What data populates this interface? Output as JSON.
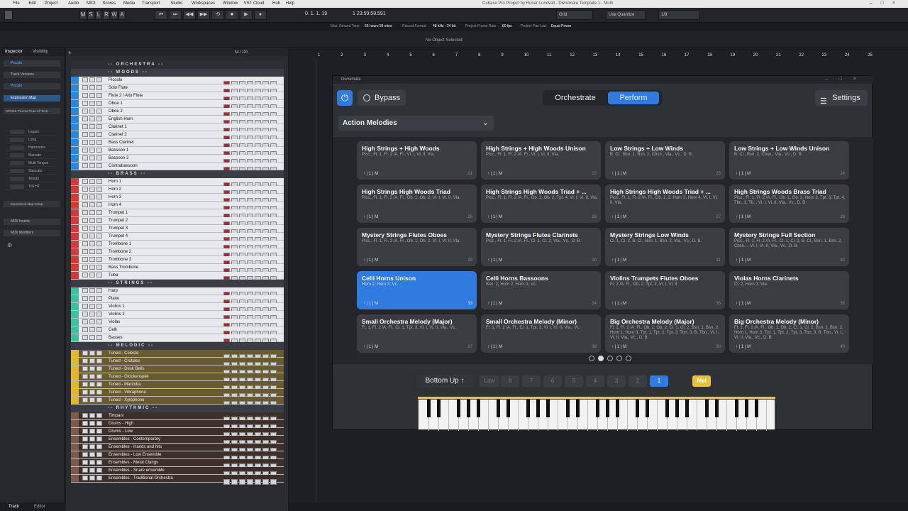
{
  "menu": [
    "File",
    "Edit",
    "Project",
    "Audio",
    "MIDI",
    "Scores",
    "Media",
    "Transport",
    "Studio",
    "Workspaces",
    "Window",
    "VST Cloud",
    "Hub",
    "Help"
  ],
  "window_title": "Cubase Pro Project by Runar Lundvall - Divisimate Template 1 - Multi",
  "toolbar": {
    "modes": [
      "M",
      "S",
      "L",
      "R",
      "W",
      "A"
    ],
    "position": "0. 1. 1. 19",
    "time": "1 23:59:58.591",
    "grid": "Grid",
    "quantize": "Use Quantize",
    "quant_value": "1/8"
  },
  "status": {
    "max_record_label": "Max. Record Time",
    "max_record": "56 hours 59 mins",
    "format_label": "Record Format",
    "format": "48 kHz - 24 bit",
    "frame_label": "Project Frame Rate",
    "frame": "60 fps",
    "pan_label": "Project Pan Law",
    "pan": "Equal Power"
  },
  "no_object": "No Object Selected",
  "inspector": {
    "tab1": "Inspector",
    "tab2": "Visibility",
    "track": "Piccolo",
    "versions": "Track Versions",
    "track2": "Piccolo",
    "expr_map": "Expression Map",
    "expr_value": "SPSOK Piccolo Flute All Tech.",
    "articulations": [
      "Legato",
      "Long",
      "Harmonics",
      "Marcato",
      "Multi Tongue",
      "Staccato",
      "Tenuto",
      "Trill HT"
    ],
    "expr_setup": "Expression Map Setup",
    "midi_inserts": "MIDI Inserts",
    "midi_modifiers": "MIDI Modifiers",
    "bottom_tabs": [
      "Track",
      "Editor"
    ]
  },
  "tracklist": {
    "counter": "54 / 120",
    "folders": [
      "ORCHESTRA",
      "WOODS",
      "BRASS",
      "STRINGS",
      "MELODIC",
      "RHYTHMIC"
    ],
    "woods": [
      "Piccolo",
      "Solo Flute",
      "Flute 2 / Alto Flute",
      "Oboe 1",
      "Oboe 2",
      "English Horn",
      "Clarinet 1",
      "Clarinet 2",
      "Bass Clarinet",
      "Bassoon 1",
      "Bassoon 2",
      "Contrabassoon"
    ],
    "brass": [
      "Horn 1",
      "Horn 2",
      "Horn 3",
      "Horn 4",
      "Trumpet 1",
      "Trumpet 2",
      "Trumpet 3",
      "Trumpet 4",
      "Trombone 1",
      "Trombone 2",
      "Trombone 3",
      "Bass Trombone",
      "Tuba"
    ],
    "strings": [
      "Harp",
      "Piano",
      "Violins 1",
      "Violins 2",
      "Violas",
      "Celli",
      "Basses"
    ],
    "melodic": [
      "Tuned - Celeste",
      "Tuned - Crotales",
      "Tuned - Desk Bells",
      "Tuned - Glockenspiel",
      "Tuned - Marimba",
      "Tuned - Vibraphone",
      "Tuned - Xylophone"
    ],
    "rhythmic": [
      "Timpani",
      "Drums - High",
      "Drums - Low",
      "Ensembles - Contemporary",
      "Ensembles - Hands and hits",
      "Ensembles - Low Ensemble",
      "Ensembles - Metal Clangs",
      "Ensembles - Snare ensemble",
      "Ensembles - Traditional Orchestra"
    ]
  },
  "ruler": [
    "1",
    "2",
    "3",
    "4",
    "5",
    "6",
    "7",
    "8",
    "9",
    "10",
    "11",
    "12",
    "13",
    "14",
    "15",
    "16",
    "17",
    "18",
    "19",
    "20",
    "21",
    "22",
    "23",
    "24",
    "25"
  ],
  "plugin": {
    "title": "Divisimate",
    "bypass": "Bypass",
    "tabs": [
      "Orchestrate",
      "Perform"
    ],
    "active_tab": "Perform",
    "settings": "Settings",
    "dropdown": "Action Melodies",
    "cards": [
      {
        "t": "High Strings + High Woods",
        "s": "Picc., Fl. 1, Fl. 2 /A. Fl., Vl. I, Vl. II, Vla.",
        "n": "21"
      },
      {
        "t": "High Strings + High Woods Unison",
        "s": "Picc., Fl. 1, Fl. 2 /A. Fl., Vl. I, Vl. II, Vla.",
        "n": "22"
      },
      {
        "t": "Low Strings + Low Winds",
        "s": "B. Cl., Bsn. 1, Bsn. 2, Cbsn., Vla., Vc., D. B.",
        "n": "23"
      },
      {
        "t": "Low Strings + Low Winds Unison",
        "s": "B. Cl., Bsn. 2, Cbsn., Vla., Vc., D. B.",
        "n": "24"
      },
      {
        "t": "High Strings High Woods Triad",
        "s": "Picc., Fl. 1, Fl. 2 /A. Fl., Ob. 1, Ob. 2, Vl. I, Vl. II, Vla.",
        "n": "25"
      },
      {
        "t": "High Strings High Woods Triad + ...",
        "s": "Picc., Fl. 1, Fl. 2 /A. Fl., Ob. 1, Ob. 2, Tpt. 4, Vl. I, Vl. II, Vla.",
        "n": "26"
      },
      {
        "t": "High Strings High Woods Triad + ...",
        "s": "Picc., Fl. 1, Fl. 2 /A. Fl., Ob. 1, 2. Horn 3, Horn 4, Vl. I, Vl. II, Vla.",
        "n": "27"
      },
      {
        "t": "High Strings Woods Brass Triad",
        "s": "Picc., Fl. 1, Fl. 2 /A. Fl., Ob. 1, Ob. 2, Horn 3, Tpt. 3, Tpt. 4, Tbn. 3, Tb. , Vl. I, Vl. II, Vla., Vc., D. B.",
        "n": "28"
      },
      {
        "t": "Mystery Strings Flutes Oboes",
        "s": "Picc., Fl. 1, Fl. 2 /A. Fl., Ob. 1, Ob. 2, Vl. I, Vl. II, Vla.",
        "n": "29"
      },
      {
        "t": "Mystery Strings Flutes Clarinets",
        "s": "Picc., Fl. 1, Fl. 2 /A. Fl., Cl. 1, Cl. 2, Vla., Vc., D. B.",
        "n": "30"
      },
      {
        "t": "Mystery Strings Low Winds",
        "s": "Cl. 1, Cl. 2, B. Cl., Bsn. 1, Bsn. 2, Vla., Vc., D. B.",
        "n": "31"
      },
      {
        "t": "Mystery Strings Full Section",
        "s": "Picc., Fl. 1, Fl. 2 /A. Fl., Cl. 1, Cl. 2, B. Cl., Bsn. 1, Bsn. 2, Cbsn., , Vl. I, Vl. II, Vla., Vc., D. B.",
        "n": "32"
      },
      {
        "t": "Celli Horns Unison",
        "s": "Horn 2, Horn 3, Vc.",
        "n": "33"
      },
      {
        "t": "Celli Horns Bassoons",
        "s": "Bsn. 2, Horn 2, Horn 3, Vc.",
        "n": "34"
      },
      {
        "t": "Violins Trumpets Flutes Oboes",
        "s": "Fl. 2 /A. Fl., Ob. 2, Tpt. 2, Vl. I, Vl. II",
        "n": "35"
      },
      {
        "t": "Violas Horns Clarinets",
        "s": "Cl. 2, Horn 3, Vla.",
        "n": "36"
      },
      {
        "t": "Small Orchestra Melody (Major)",
        "s": "Fl. 1, Fl. 2 /A. Fl., Cl. 1, Tpt. 3, Vl. I, Vl. II, Vla., Vc.",
        "n": "37"
      },
      {
        "t": "Small Orchestra Melody (Minor)",
        "s": "Fl. 1, Fl. 2 /A. Fl., Cl. 1, Tpt. 3, Vl. I, Vl. II, Vla., Vc.",
        "n": "38"
      },
      {
        "t": "Big Orchestra Melody (Major)",
        "s": "Fl. 1, Fl. 2 /A. Fl., Ob. 1, Ob. 2, Cl. 1, Cl. 2, Bsn. 1, Bsn. 2, Horn 1, Horn 3, Tpt. 1, Tpt. 2, Tpt. 3, Tbn. 3, B. Tbn., Vl. I, Vl. II, Vla., Vc., D. B.",
        "n": "39"
      },
      {
        "t": "Big Orchestra Melody (Minor)",
        "s": "Fl. 1, Fl. 2 /A. Fl., Ob. 1, Ob. 2, Cl. 1, Cl. 2, Bsn. 1, Bsn. 2, Horn 1, Horn 3, Tpt. 1, Tpt. 2, Tpt. 3, Tbn. 3, B. Tbn., Vl. I, Vl. II, Vla., Vc., D. B.",
        "n": "40"
      }
    ],
    "selected_card": "Celli Horns Unison",
    "card_footer": "↑ | 1 | M",
    "page_count": 5,
    "active_page": 2,
    "voicing": "Bottom Up ↑",
    "voice_buttons": [
      "Low",
      "8",
      "7",
      "6",
      "5",
      "4",
      "3",
      "2",
      "1"
    ],
    "active_voice": "1",
    "mel": "Mel",
    "colors": {
      "accent": "#2f7be0",
      "mel": "#e8c23a"
    }
  }
}
